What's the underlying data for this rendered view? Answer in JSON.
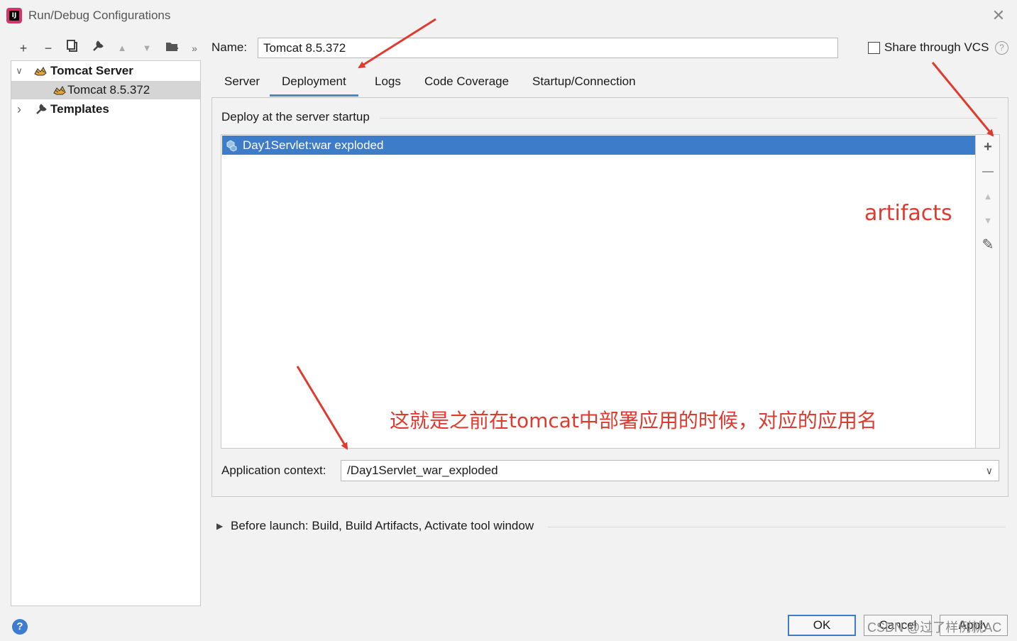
{
  "window": {
    "title": "Run/Debug Configurations",
    "app_icon_text": "IJ"
  },
  "toolbar": {
    "add": "+",
    "remove": "−",
    "copy": "⧉",
    "edit": "🔧",
    "up": "▲",
    "down": "▼",
    "folder": "📁",
    "more": "»"
  },
  "tree": {
    "items": [
      {
        "label": "Tomcat Server",
        "chevron": "∨",
        "bold": true
      },
      {
        "label": "Tomcat 8.5.372",
        "selected": true
      },
      {
        "label": "Templates",
        "chevron": "›",
        "bold": true
      }
    ]
  },
  "config": {
    "name_label": "Name:",
    "name_value": "Tomcat 8.5.372",
    "share_vcs_label": "Share through VCS",
    "share_vcs_checked": false,
    "help_glyph": "?"
  },
  "tabs": [
    {
      "label": "Server"
    },
    {
      "label": "Deployment",
      "active": true
    },
    {
      "label": "Logs"
    },
    {
      "label": "Code Coverage"
    },
    {
      "label": "Startup/Connection"
    }
  ],
  "deployment": {
    "section_title": "Deploy at the server startup",
    "items": [
      {
        "label": "Day1Servlet:war exploded",
        "selected": true
      }
    ],
    "side_tools": {
      "add": "+",
      "remove": "—",
      "up": "▲",
      "down": "▼",
      "edit": "✎"
    },
    "app_context_label": "Application context:",
    "app_context_value": "/Day1Servlet_war_exploded"
  },
  "before_launch": {
    "label": "Before launch: Build, Build Artifacts, Activate tool window"
  },
  "buttons": {
    "ok": "OK",
    "cancel": "Cancel",
    "apply": "Apply",
    "help": "?"
  },
  "annotations": {
    "artifacts": "artifacts",
    "note": "这就是之前在tomcat中部署应用的时候，对应的应用名",
    "color": "#e03a2f"
  },
  "watermark": "CSDN @过了样例就AC",
  "colors": {
    "selection": "#3d7cc9",
    "tab_underline": "#4a88c7",
    "tree_selection": "#d5d5d5"
  }
}
